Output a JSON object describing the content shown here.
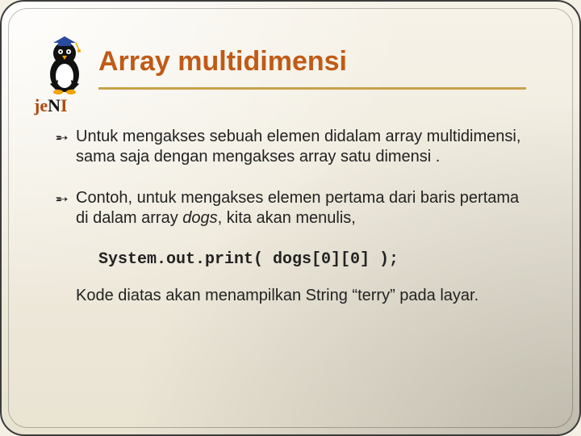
{
  "title": "Array multidimensi",
  "para1": "Untuk mengakses sebuah elemen didalam array multidimensi, sama saja dengan mengakses array satu dimensi .",
  "para2_lead": "Contoh, untuk mengakses elemen pertama dari baris pertama di dalam array ",
  "para2_em": "dogs",
  "para2_tail": ", kita akan menulis,",
  "code_line": "System.out.print( dogs[0][0] );",
  "closing": "Kode diatas akan menampilkan String “terry” pada layar.",
  "logo_text": "jeNI"
}
